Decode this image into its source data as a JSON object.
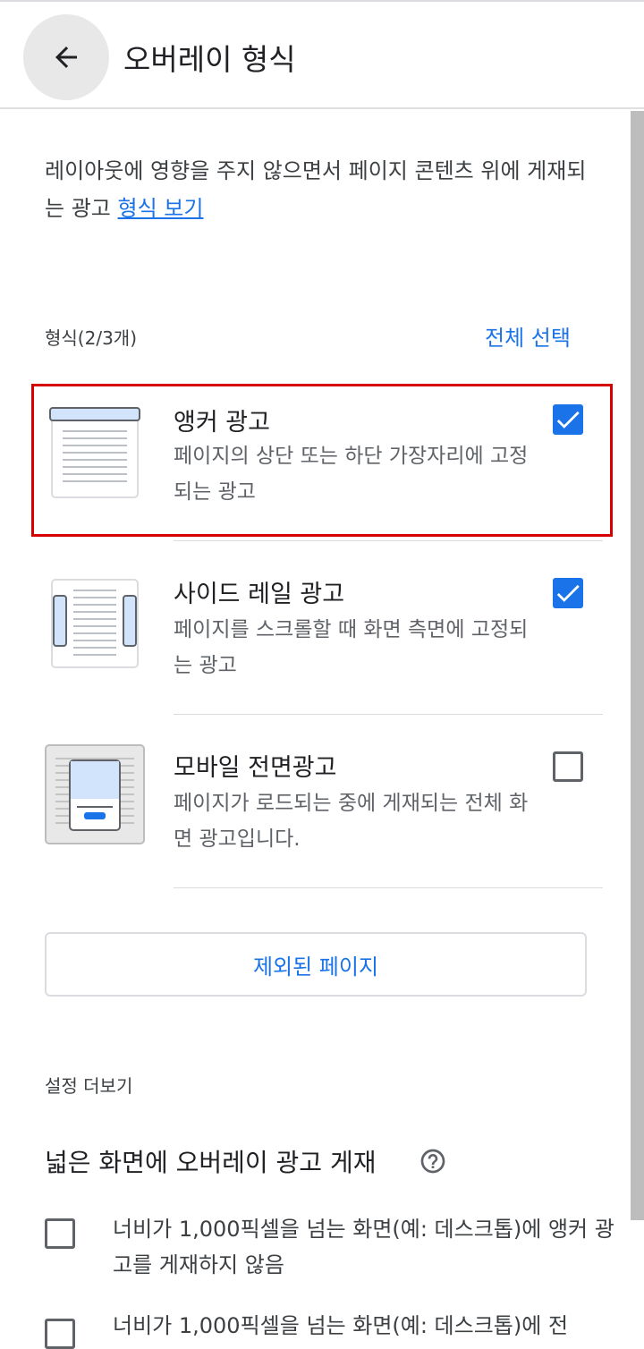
{
  "header": {
    "title": "오버레이 형식",
    "back_icon": "arrow-left-icon"
  },
  "description": {
    "text": "레이아웃에 영향을 주지 않으면서 페이지 콘텐츠 위에 게재되는 광고 ",
    "link": "형식 보기"
  },
  "formats": {
    "count_label": "형식(2/3개)",
    "select_all": "전체 선택",
    "items": [
      {
        "title": "앵커 광고",
        "desc": "페이지의 상단 또는 하단 가장자리에 고정되는 광고",
        "checked": true,
        "icon": "anchor-ad-icon"
      },
      {
        "title": "사이드 레일 광고",
        "desc": "페이지를 스크롤할 때 화면 측면에 고정되는 광고",
        "checked": true,
        "icon": "side-rail-ad-icon"
      },
      {
        "title": "모바일 전면광고",
        "desc": "페이지가 로드되는 중에 게재되는 전체 화면 광고입니다.",
        "checked": false,
        "icon": "mobile-interstitial-icon"
      }
    ]
  },
  "excluded_pages_button": "제외된 페이지",
  "more_settings": {
    "label": "설정 더보기",
    "wide_screen_title": "넓은 화면에 오버레이 광고 게재",
    "help_icon": "help-circle-icon",
    "options": [
      {
        "text": "너비가 1,000픽셀을 넘는 화면(예: 데스크톱)에 앵커 광고를 게재하지 않음",
        "checked": false
      },
      {
        "text": "너비가 1,000픽셀을 넘는 화면(예: 데스크톱)에 전",
        "checked": false
      }
    ]
  },
  "colors": {
    "accent": "#1a73e8",
    "highlight": "#d50000"
  }
}
